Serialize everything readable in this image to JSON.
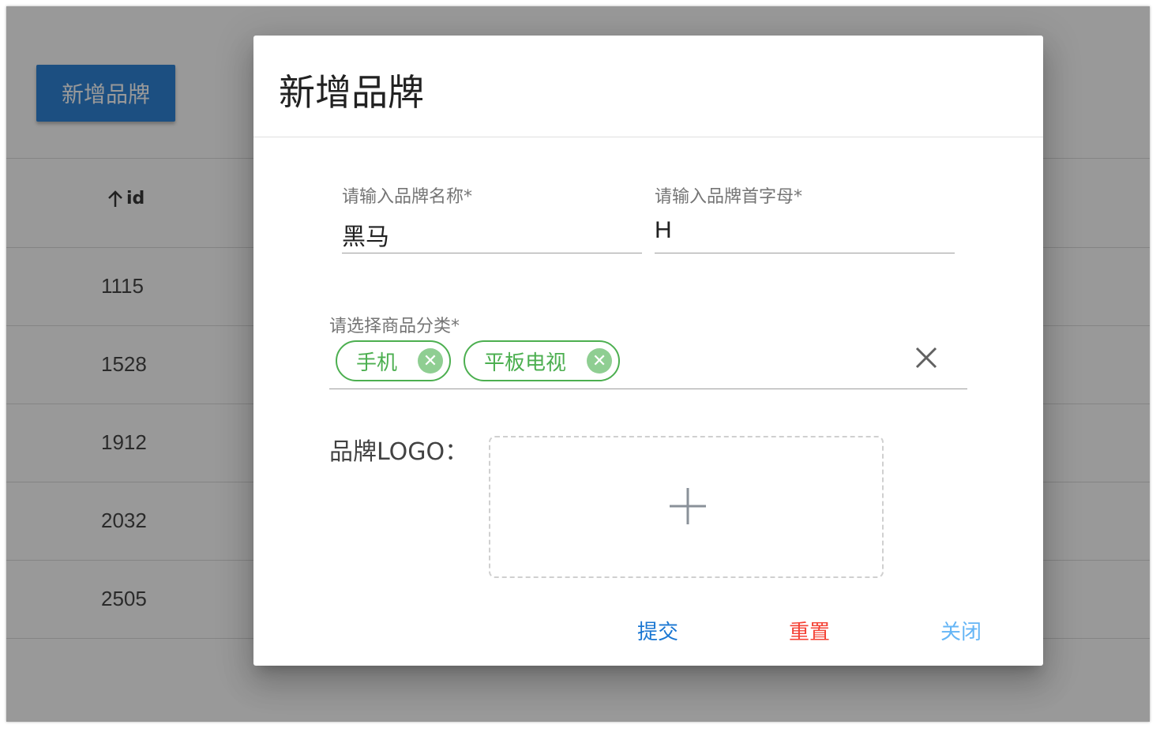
{
  "background": {
    "add_button_label": "新增品牌",
    "id_header": "id",
    "sort_icon": "arrow-up-icon",
    "ids": [
      "1115",
      "1528",
      "1912",
      "2032",
      "2505"
    ]
  },
  "dialog": {
    "title": "新增品牌",
    "name_field": {
      "label": "请输入品牌名称*",
      "value": "黑马"
    },
    "letter_field": {
      "label": "请输入品牌首字母*",
      "value": "H"
    },
    "category_field": {
      "label": "请选择商品分类*",
      "chips": [
        "手机",
        "平板电视"
      ],
      "chip_remove_icon": "close-circle-icon",
      "clear_icon": "close-icon"
    },
    "logo_label": "品牌LOGO：",
    "upload_icon": "plus-icon",
    "actions": {
      "submit": "提交",
      "reset": "重置",
      "close": "关闭"
    }
  },
  "colors": {
    "primary": "#1976d2",
    "chip_green": "#4caf50",
    "reset_red": "#f44336",
    "close_light_blue": "#64b5f6"
  }
}
